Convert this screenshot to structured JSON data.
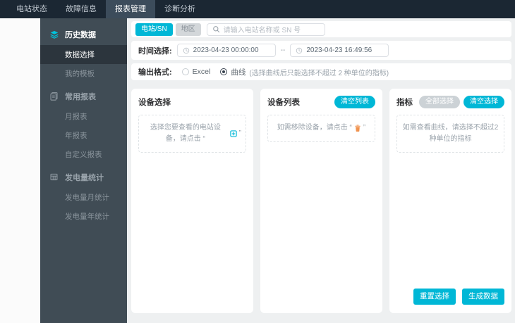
{
  "navbar": {
    "items": [
      {
        "label": "电站状态",
        "active": false
      },
      {
        "label": "故障信息",
        "active": false
      },
      {
        "label": "报表管理",
        "active": true
      },
      {
        "label": "诊断分析",
        "active": false
      }
    ]
  },
  "sidebar": {
    "sections": [
      {
        "icon": "layers-icon",
        "label": "历史数据",
        "active": true,
        "children": [
          {
            "label": "数据选择",
            "active": true
          },
          {
            "label": "我的模板",
            "active": false
          }
        ]
      },
      {
        "icon": "report-icon",
        "label": "常用报表",
        "active": false,
        "children": [
          {
            "label": "月报表",
            "active": false
          },
          {
            "label": "年报表",
            "active": false
          },
          {
            "label": "自定义报表",
            "active": false
          }
        ]
      },
      {
        "icon": "table-icon",
        "label": "发电量统计",
        "active": false,
        "children": [
          {
            "label": "发电量月统计",
            "active": false
          },
          {
            "label": "发电量年统计",
            "active": false
          }
        ]
      }
    ]
  },
  "toolbar": {
    "station_toggle": "电站/SN",
    "region_toggle": "地区",
    "search_placeholder": "请输入电站名称或 SN 号"
  },
  "time_filter": {
    "label": "时间选择:",
    "start": "2023-04-23 00:00:00",
    "separator": "--",
    "end": "2023-04-23 16:49:56"
  },
  "output_format": {
    "label": "输出格式:",
    "excel_label": "Excel",
    "curve_label": "曲线",
    "curve_note": "(选择曲线后只能选择不超过 2 种单位的指标)",
    "selected": "curve"
  },
  "panels": {
    "device_select": {
      "title": "设备选择",
      "hint_prefix": "选择您要查看的电站设备，请点击 “",
      "hint_suffix": "”"
    },
    "device_list": {
      "title": "设备列表",
      "clear_button": "清空列表",
      "hint_prefix": "如需移除设备，请点击 “",
      "hint_suffix": "”"
    },
    "indicators": {
      "title": "指标",
      "select_all_button": "全部选择",
      "clear_button": "清空选择",
      "hint": "如需查看曲线，请选择不超过2种单位的指标"
    }
  },
  "footer_actions": {
    "reset": "重置选择",
    "generate": "生成数据"
  },
  "colors": {
    "accent": "#00b7d6",
    "navbar_bg": "#1b2733",
    "sidebar_bg": "#404c55",
    "trash_icon": "#f0924e"
  }
}
